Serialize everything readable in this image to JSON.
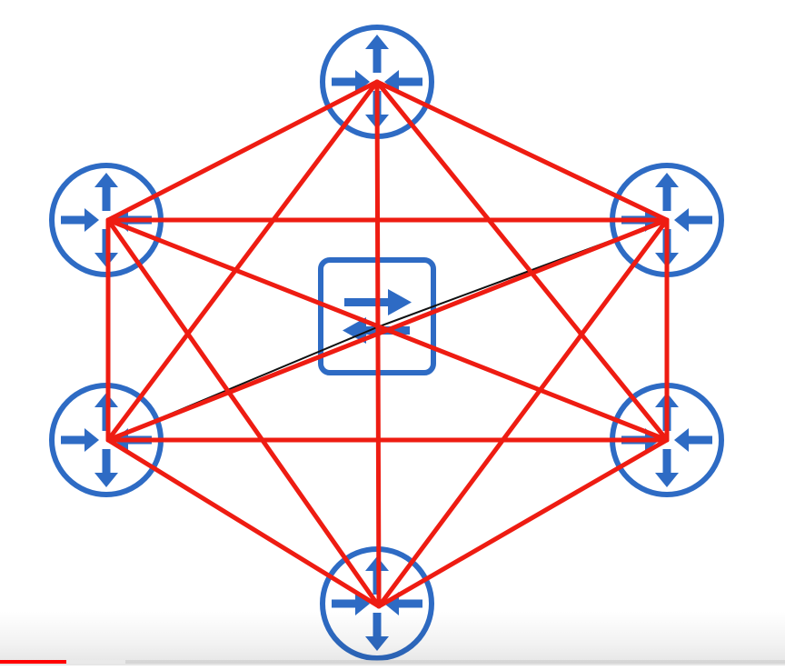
{
  "diagram": {
    "colors": {
      "device": "#2e6bc4",
      "link": "#ee1c12",
      "link_thin": "#111111",
      "background": "#ffffff"
    },
    "routers": [
      {
        "id": "router-top",
        "icon": "router-icon"
      },
      {
        "id": "router-upper-left",
        "icon": "router-icon"
      },
      {
        "id": "router-upper-right",
        "icon": "router-icon"
      },
      {
        "id": "router-lower-left",
        "icon": "router-icon"
      },
      {
        "id": "router-lower-right",
        "icon": "router-icon"
      },
      {
        "id": "router-bottom",
        "icon": "router-icon"
      }
    ],
    "switch": {
      "id": "switch-center",
      "icon": "switch-icon"
    },
    "links": [
      [
        "router-top",
        "router-upper-left"
      ],
      [
        "router-top",
        "router-upper-right"
      ],
      [
        "router-top",
        "router-lower-left"
      ],
      [
        "router-top",
        "router-lower-right"
      ],
      [
        "router-top",
        "router-bottom"
      ],
      [
        "router-upper-left",
        "router-upper-right"
      ],
      [
        "router-upper-left",
        "router-lower-left"
      ],
      [
        "router-upper-left",
        "router-lower-right"
      ],
      [
        "router-upper-left",
        "router-bottom"
      ],
      [
        "router-upper-right",
        "router-lower-left"
      ],
      [
        "router-upper-right",
        "router-lower-right"
      ],
      [
        "router-upper-right",
        "router-bottom"
      ],
      [
        "router-lower-left",
        "router-lower-right"
      ],
      [
        "router-lower-left",
        "router-bottom"
      ],
      [
        "router-lower-right",
        "router-bottom"
      ]
    ],
    "thin_links": [
      [
        "router-upper-left",
        "switch-center"
      ],
      [
        "router-lower-right",
        "switch-center"
      ],
      [
        "router-lower-left",
        "switch-center"
      ],
      [
        "router-upper-right",
        "switch-center"
      ]
    ]
  },
  "player": {
    "progress_fraction": 0.085,
    "buffered_fraction": 0.16,
    "progress_color": "#ff0000"
  }
}
